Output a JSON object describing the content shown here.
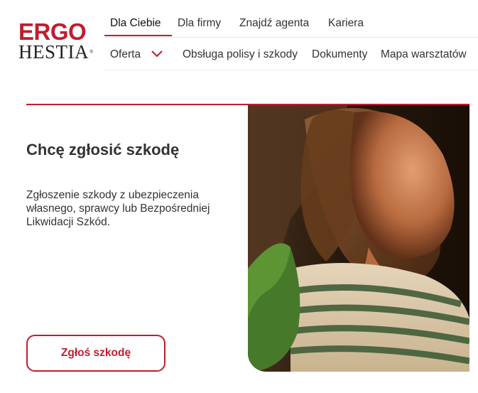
{
  "logo": {
    "line1": "ERGO",
    "line2": "HESTIA",
    "reg": "®"
  },
  "top_nav": {
    "items": [
      "Dla Ciebie",
      "Dla firmy",
      "Znajdź agenta",
      "Kariera"
    ],
    "active": "Dla Ciebie"
  },
  "sub_nav": {
    "items": [
      "Oferta",
      "Obsługa polisy i szkody",
      "Dokumenty",
      "Mapa warsztatów"
    ]
  },
  "hero": {
    "title": "Chcę zgłosić szkodę",
    "description": "Zgłoszenie szkody z ubezpieczenia własnego, sprawcy lub Bezpośredniej Likwidacji Szkód.",
    "cta_label": "Zgłoś szkodę",
    "image_icon": "woman-portrait-photo"
  },
  "colors": {
    "brand": "#bf1e2e",
    "text": "#333333",
    "border": "#e4e4e4"
  }
}
